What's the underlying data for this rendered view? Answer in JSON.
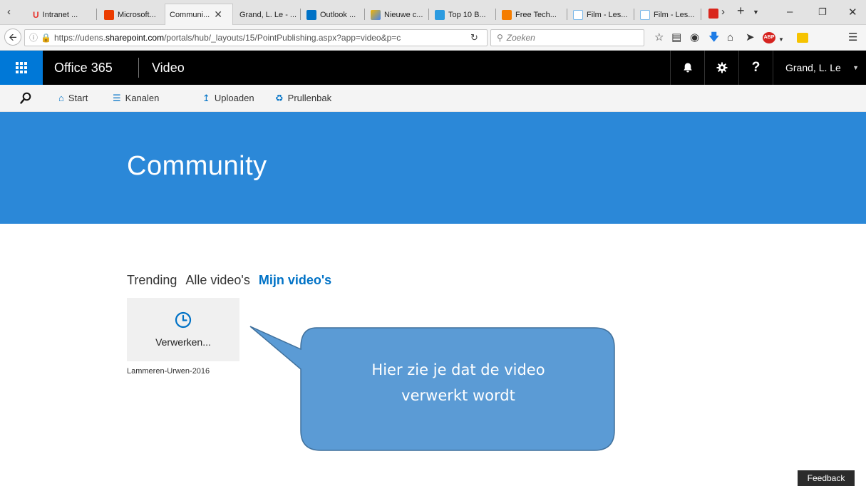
{
  "browser": {
    "tabs": [
      {
        "label": "Intranet ...",
        "favicon_color": "#e8322b"
      },
      {
        "label": "Microsoft...",
        "favicon_color": "#eb3c00"
      },
      {
        "label": "Communi...",
        "favicon_color": "",
        "active": true
      },
      {
        "label": "Grand, L. Le - ...",
        "favicon_color": ""
      },
      {
        "label": "Outlook ...",
        "favicon_color": "#0072c6"
      },
      {
        "label": "Nieuwe c...",
        "favicon_color": "#f4b400"
      },
      {
        "label": "Top 10 B...",
        "favicon_color": "#2b9be0"
      },
      {
        "label": "Free Tech...",
        "favicon_color": "#f57d00"
      },
      {
        "label": "Film - Les...",
        "favicon_color": "#7ab7e8"
      },
      {
        "label": "Film - Les...",
        "favicon_color": "#7ab7e8"
      }
    ],
    "url_prefix": "https://udens.",
    "url_domain": "sharepoint.com",
    "url_path": "/portals/hub/_layouts/15/PointPublishing.aspx?app=video&p=c",
    "search_placeholder": "Zoeken"
  },
  "suitebar": {
    "brand": "Office 365",
    "app": "Video",
    "user": "Grand, L. Le",
    "help_label": "?"
  },
  "commandbar": {
    "start": "Start",
    "channels": "Kanalen",
    "upload": "Uploaden",
    "recycle": "Prullenbak"
  },
  "hero": {
    "title": "Community"
  },
  "pivots": [
    {
      "label": "Trending",
      "active": false
    },
    {
      "label": "Alle video's",
      "active": false
    },
    {
      "label": "Mijn video's",
      "active": true
    }
  ],
  "video_tile": {
    "status": "Verwerken...",
    "caption": "Lammeren-Urwen-2016"
  },
  "callout": {
    "line1": "Hier zie je dat de video",
    "line2": "verwerkt wordt"
  },
  "feedback_label": "Feedback",
  "colors": {
    "accent": "#0072c6",
    "hero": "#2b88d8",
    "callout_fill": "#5b9bd5",
    "callout_border": "#41719c"
  }
}
